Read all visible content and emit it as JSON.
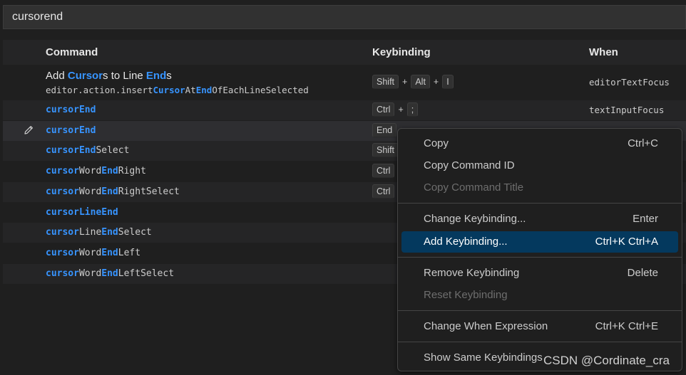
{
  "search": {
    "value": "cursorend"
  },
  "headers": {
    "command": "Command",
    "keybinding": "Keybinding",
    "when": "When"
  },
  "rows": [
    {
      "title": [
        {
          "t": "Add ",
          "h": false
        },
        {
          "t": "Cursor",
          "h": true
        },
        {
          "t": "s to Line ",
          "h": false
        },
        {
          "t": "End",
          "h": true
        },
        {
          "t": "s",
          "h": false
        }
      ],
      "command_id": [
        {
          "t": "editor.action.insert",
          "h": false
        },
        {
          "t": "Cursor",
          "h": true
        },
        {
          "t": "At",
          "h": false
        },
        {
          "t": "End",
          "h": true
        },
        {
          "t": "OfEachLineSelected",
          "h": false
        }
      ],
      "keys": [
        "Shift",
        "Alt",
        "I"
      ],
      "when": "editorTextFocus"
    },
    {
      "command": [
        {
          "t": "cursorEnd",
          "h": true
        }
      ],
      "keys": [
        "Ctrl",
        ";"
      ],
      "when": "textInputFocus"
    },
    {
      "command": [
        {
          "t": "cursorEnd",
          "h": true
        }
      ],
      "keys": [
        "End"
      ],
      "when": ""
    },
    {
      "command": [
        {
          "t": "cursorEnd",
          "h": true
        },
        {
          "t": "Select",
          "h": false
        }
      ],
      "keys": [
        "Shift"
      ],
      "when": ""
    },
    {
      "command": [
        {
          "t": "cursor",
          "h": true
        },
        {
          "t": "Word",
          "h": false
        },
        {
          "t": "End",
          "h": true
        },
        {
          "t": "Right",
          "h": false
        }
      ],
      "keys": [
        "Ctrl"
      ],
      "when": ""
    },
    {
      "command": [
        {
          "t": "cursor",
          "h": true
        },
        {
          "t": "Word",
          "h": false
        },
        {
          "t": "End",
          "h": true
        },
        {
          "t": "RightSelect",
          "h": false
        }
      ],
      "keys": [
        "Ctrl"
      ],
      "when": ""
    },
    {
      "command": [
        {
          "t": "cursor",
          "h": true
        },
        {
          "t": "LineEnd",
          "h": true
        }
      ],
      "keys": [],
      "when": ""
    },
    {
      "command": [
        {
          "t": "cursor",
          "h": true
        },
        {
          "t": "Line",
          "h": false
        },
        {
          "t": "End",
          "h": true
        },
        {
          "t": "Select",
          "h": false
        }
      ],
      "keys": [],
      "when": ""
    },
    {
      "command": [
        {
          "t": "cursor",
          "h": true
        },
        {
          "t": "Word",
          "h": false
        },
        {
          "t": "End",
          "h": true
        },
        {
          "t": "Left",
          "h": false
        }
      ],
      "keys": [],
      "when": ""
    },
    {
      "command": [
        {
          "t": "cursor",
          "h": true
        },
        {
          "t": "Word",
          "h": false
        },
        {
          "t": "End",
          "h": true
        },
        {
          "t": "LeftSelect",
          "h": false
        }
      ],
      "keys": [],
      "when": ""
    }
  ],
  "key_separator": "+",
  "context_menu": {
    "items": [
      {
        "label": "Copy",
        "shortcut": "Ctrl+C",
        "disabled": false
      },
      {
        "label": "Copy Command ID",
        "shortcut": "",
        "disabled": false
      },
      {
        "label": "Copy Command Title",
        "shortcut": "",
        "disabled": true
      },
      {
        "label": "Change Keybinding...",
        "shortcut": "Enter",
        "disabled": false
      },
      {
        "label": "Add Keybinding...",
        "shortcut": "Ctrl+K Ctrl+A",
        "disabled": false,
        "active": true
      },
      {
        "label": "Remove Keybinding",
        "shortcut": "Delete",
        "disabled": false
      },
      {
        "label": "Reset Keybinding",
        "shortcut": "",
        "disabled": true
      },
      {
        "label": "Change When Expression",
        "shortcut": "Ctrl+K Ctrl+E",
        "disabled": false
      },
      {
        "label": "Show Same Keybindings",
        "shortcut": "",
        "disabled": false
      }
    ]
  },
  "watermark": "CSDN @Cordinate_cra",
  "colors": {
    "highlight": "#3794ff",
    "active_menu": "#04395e",
    "background": "#1f1f1f"
  },
  "icons": {
    "edit": "pencil-icon"
  }
}
